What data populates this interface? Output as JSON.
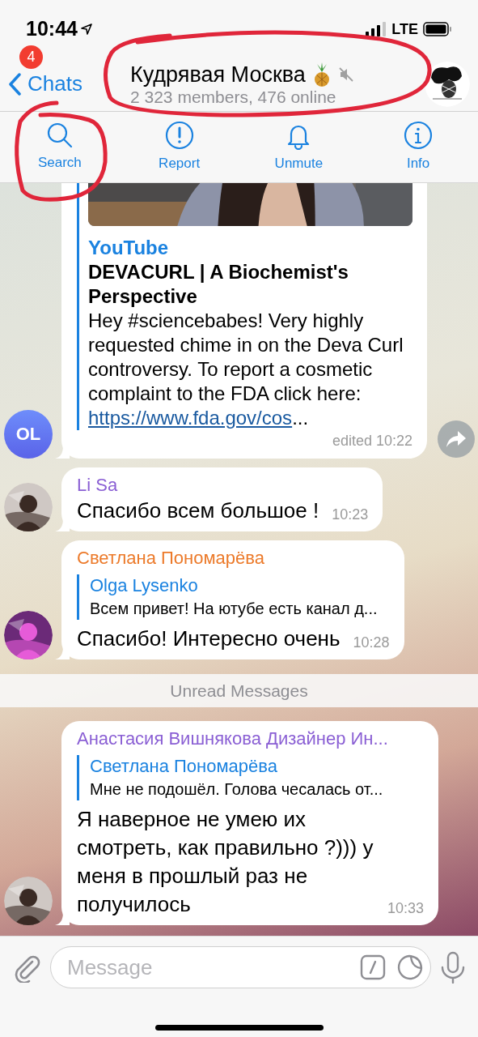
{
  "status_bar": {
    "time": "10:44",
    "network": "LTE"
  },
  "header": {
    "back_label": "Chats",
    "unread_badge": "4",
    "title": "Кудрявая Москва",
    "muted": true,
    "subtitle": "2 323 members, 476 online"
  },
  "actions": [
    {
      "kind": "search",
      "label": "Search"
    },
    {
      "kind": "report",
      "label": "Report"
    },
    {
      "kind": "unmute",
      "label": "Unmute"
    },
    {
      "kind": "info",
      "label": "Info"
    }
  ],
  "messages": [
    {
      "kind": "link_preview",
      "avatar": {
        "kind": "initials",
        "text": "OL"
      },
      "site": "YouTube",
      "preview_title": "DEVACURL | A Biochemist's Perspective",
      "preview_text": "Hey #sciencebabes! Very highly requested chime in on the Deva Curl controversy. To report a cosmetic complaint to the FDA click here:",
      "link": "https://www.fda.gov/cos",
      "link_suffix": "...",
      "time": "edited 10:22",
      "forward": true
    },
    {
      "kind": "text",
      "sender": "Li Sa",
      "color": "#8a5fd4",
      "text": "Спасибо всем большое !",
      "time": "10:23"
    },
    {
      "kind": "reply",
      "sender": "Светлана Пономарёва",
      "color": "#ec7a2a",
      "reply_to": "Olga Lysenko",
      "reply_text": "Всем привет! На ютубе есть канал д...",
      "text": "Спасибо! Интересно очень",
      "time": "10:28"
    },
    {
      "kind": "divider",
      "text": "Unread Messages"
    },
    {
      "kind": "reply",
      "sender": "Анастасия Вишнякова Дизайнер Ин...",
      "color": "#8a5fd4",
      "reply_to": "Светлана Пономарёва",
      "reply_text": "Мне не подошёл. Голова чесалась от...",
      "text": "Я наверное не умею их смотреть, как правильно ?))) у меня в прошлый раз не получилось",
      "time": "10:33"
    }
  ],
  "composer": {
    "placeholder": "Message"
  }
}
